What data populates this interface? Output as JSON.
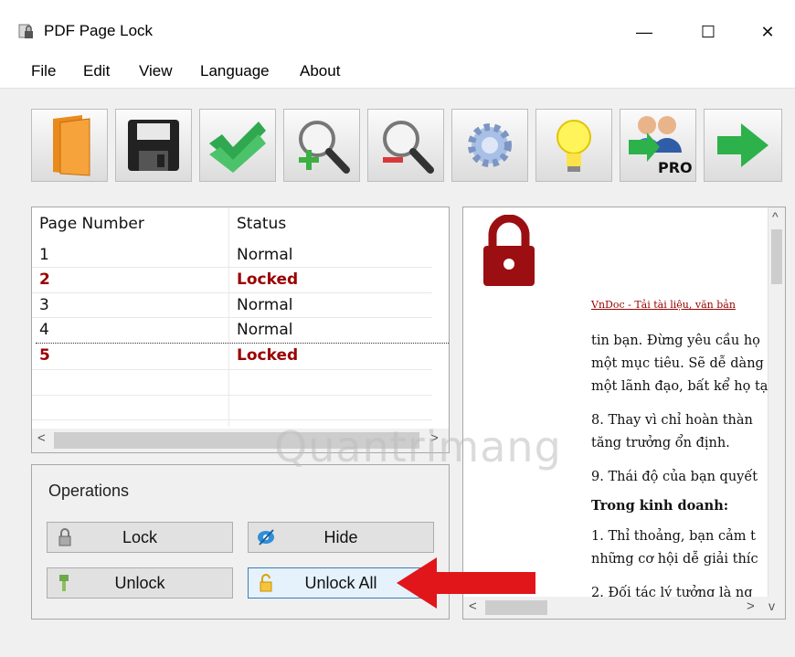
{
  "window": {
    "title": "PDF Page Lock",
    "minimize": "—",
    "maximize": "☐",
    "close": "✕"
  },
  "menu": [
    "File",
    "Edit",
    "View",
    "Language",
    "About"
  ],
  "toolbar": [
    {
      "name": "open-folder"
    },
    {
      "name": "save"
    },
    {
      "name": "apply-check"
    },
    {
      "name": "zoom-in"
    },
    {
      "name": "zoom-out"
    },
    {
      "name": "settings"
    },
    {
      "name": "tips"
    },
    {
      "name": "pro-users"
    },
    {
      "name": "next"
    }
  ],
  "pages": {
    "headers": [
      "Page Number",
      "Status"
    ],
    "rows": [
      {
        "page": "1",
        "status": "Normal",
        "locked": false
      },
      {
        "page": "2",
        "status": "Locked",
        "locked": true
      },
      {
        "page": "3",
        "status": "Normal",
        "locked": false
      },
      {
        "page": "4",
        "status": "Normal",
        "locked": false
      },
      {
        "page": "5",
        "status": "Locked",
        "locked": true
      }
    ],
    "hscroll": {
      "left": "<",
      "right": ">"
    }
  },
  "operations": {
    "title": "Operations",
    "lock": "Lock",
    "hide": "Hide",
    "unlock": "Unlock",
    "unlock_all": "Unlock All"
  },
  "preview": {
    "header_link": "VnDoc - Tải tài liệu, văn bản",
    "lines": [
      "tin bạn. Đừng yêu cầu họ",
      "một mục tiêu. Sẽ dễ dàng",
      "một lãnh đạo, bất kể họ tạ",
      "8. Thay vì chỉ hoàn thàn",
      "tăng trưởng ổn định.",
      "9. Thái độ của bạn quyết",
      "Trong kinh doanh:",
      "1. Thỉ thoảng, bạn cảm t",
      "những cơ hội dễ giải thíc",
      "2. Đối tác lý tưởng là ng"
    ],
    "scroll": {
      "up": "^",
      "down": "v",
      "left": "<",
      "right": ">"
    }
  },
  "watermark": "Quantrimang",
  "colors": {
    "locked": "#9b0000",
    "lock_icon": "#9b0f12",
    "arrow": "#e0161b"
  }
}
